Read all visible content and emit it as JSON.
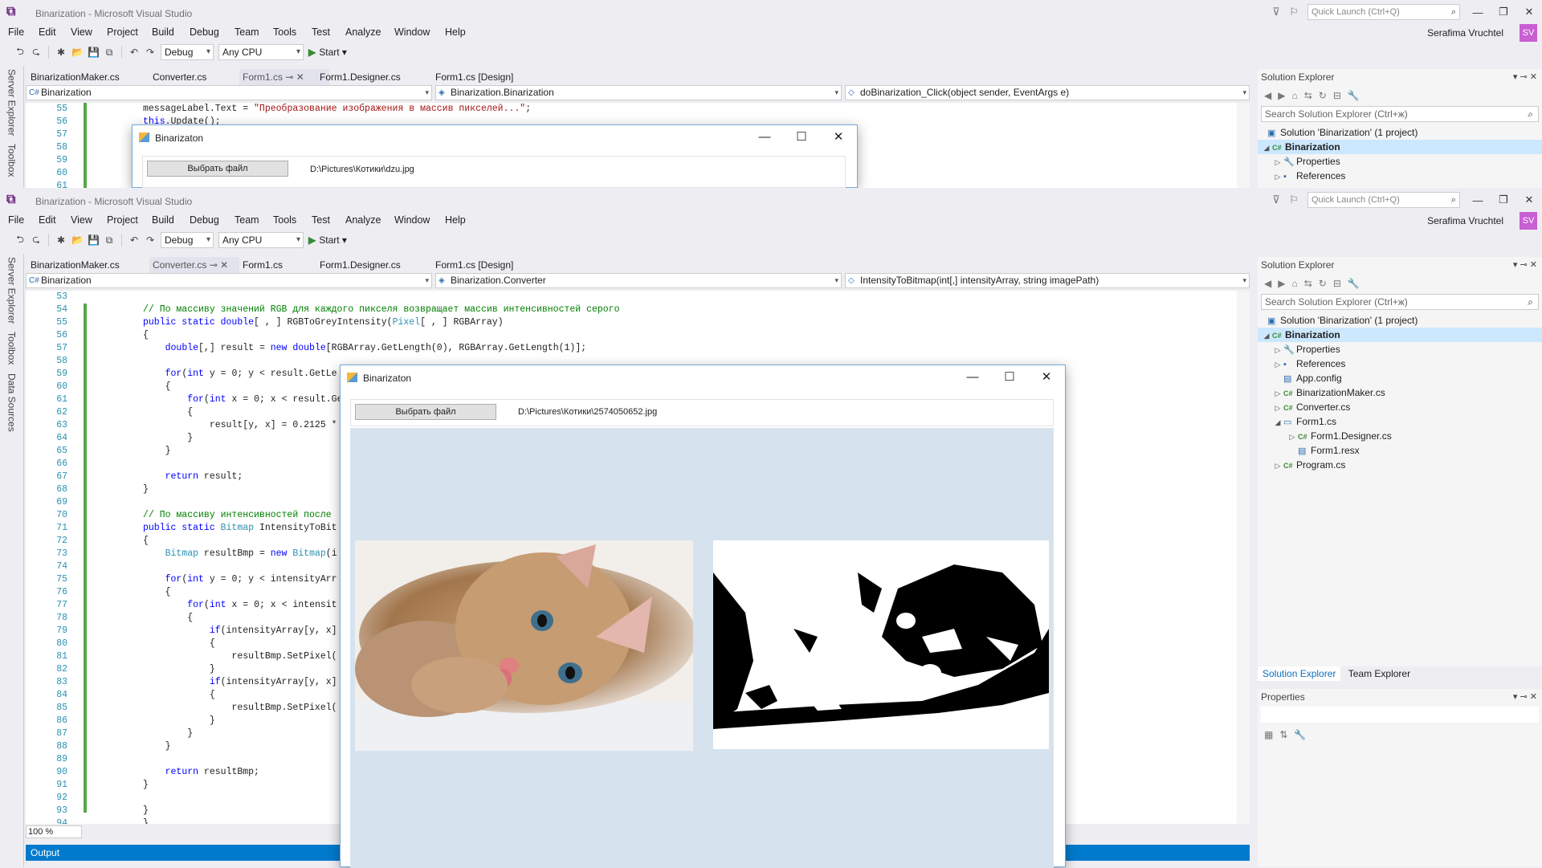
{
  "window": {
    "title": "Binarization - Microsoft Visual Studio",
    "quick_launch": "Quick Launch (Ctrl+Q)",
    "user": "Serafima Vruchtel",
    "avatar": "SV"
  },
  "menu": [
    "File",
    "Edit",
    "View",
    "Project",
    "Build",
    "Debug",
    "Team",
    "Tools",
    "Test",
    "Analyze",
    "Window",
    "Help"
  ],
  "toolbar": {
    "config": "Debug",
    "platform": "Any CPU",
    "start": "Start"
  },
  "side_tabs_top": [
    "Server Explorer",
    "Toolbox"
  ],
  "side_tabs_bottom": [
    "Server Explorer",
    "Toolbox",
    "Data Sources"
  ],
  "top_window": {
    "tabs": [
      "BinarizationMaker.cs",
      "Converter.cs",
      "Form1.cs",
      "Form1.Designer.cs",
      "Form1.cs [Design]"
    ],
    "nav": [
      "Binarization",
      "Binarization.Binarization",
      "doBinarization_Click(object sender, EventArgs e)"
    ],
    "lines": [
      {
        "n": "55",
        "html": "messageLabel.Text = <span class='st'>\"Преобразование изображения в массив пикселей...\"</span>;"
      },
      {
        "n": "56",
        "html": "<span class='kw'>this</span>.Update();"
      },
      {
        "n": "57",
        "html": ""
      },
      {
        "n": "58",
        "html": ""
      },
      {
        "n": "59",
        "html": ""
      },
      {
        "n": "60",
        "html": ""
      },
      {
        "n": "61",
        "html": ""
      }
    ],
    "form": {
      "title": "Binarizaton",
      "button": "Выбрать файл",
      "path": "D:\\Pictures\\Котики\\dzu.jpg"
    }
  },
  "bottom_window": {
    "tabs": [
      "BinarizationMaker.cs",
      "Converter.cs",
      "Form1.cs",
      "Form1.Designer.cs",
      "Form1.cs [Design]"
    ],
    "nav": [
      "Binarization",
      "Binarization.Converter",
      "IntensityToBitmap(int[,] intensityArray, string imagePath)"
    ],
    "lines": [
      {
        "n": "53",
        "html": ""
      },
      {
        "n": "54",
        "html": "<span class='cm'>// По массиву значений RGB для каждого пикселя возвращает массив интенсивностей серого</span>"
      },
      {
        "n": "55",
        "html": "<span class='kw'>public static double</span>[ , ] RGBToGreyIntensity(<span class='ty'>Pixel</span>[ , ] RGBArray)"
      },
      {
        "n": "56",
        "html": "{"
      },
      {
        "n": "57",
        "html": "    <span class='kw'>double</span>[,] result = <span class='kw'>new double</span>[RGBArray.GetLength(0), RGBArray.GetLength(1)];"
      },
      {
        "n": "58",
        "html": ""
      },
      {
        "n": "59",
        "html": "    <span class='kw'>for</span>(<span class='kw'>int</span> y = 0; y &lt; result.GetLe"
      },
      {
        "n": "60",
        "html": "    {"
      },
      {
        "n": "61",
        "html": "        <span class='kw'>for</span>(<span class='kw'>int</span> x = 0; x &lt; result.Ge"
      },
      {
        "n": "62",
        "html": "        {"
      },
      {
        "n": "63",
        "html": "            result[y, x] = 0.2125 *"
      },
      {
        "n": "64",
        "html": "        }"
      },
      {
        "n": "65",
        "html": "    }"
      },
      {
        "n": "66",
        "html": ""
      },
      {
        "n": "67",
        "html": "    <span class='kw'>return</span> result;"
      },
      {
        "n": "68",
        "html": "}"
      },
      {
        "n": "69",
        "html": ""
      },
      {
        "n": "70",
        "html": "<span class='cm'>// По массиву интенсивностей после</span>"
      },
      {
        "n": "71",
        "html": "<span class='kw'>public static</span> <span class='ty'>Bitmap</span> IntensityToBit"
      },
      {
        "n": "72",
        "html": "{"
      },
      {
        "n": "73",
        "html": "    <span class='ty'>Bitmap</span> resultBmp = <span class='kw'>new</span> <span class='ty'>Bitmap</span>(i"
      },
      {
        "n": "74",
        "html": ""
      },
      {
        "n": "75",
        "html": "    <span class='kw'>for</span>(<span class='kw'>int</span> y = 0; y &lt; intensityArr"
      },
      {
        "n": "76",
        "html": "    {"
      },
      {
        "n": "77",
        "html": "        <span class='kw'>for</span>(<span class='kw'>int</span> x = 0; x &lt; intensit"
      },
      {
        "n": "78",
        "html": "        {"
      },
      {
        "n": "79",
        "html": "            <span class='kw'>if</span>(intensityArray[y, x]"
      },
      {
        "n": "80",
        "html": "            {"
      },
      {
        "n": "81",
        "html": "                resultBmp.SetPixel("
      },
      {
        "n": "82",
        "html": "            }"
      },
      {
        "n": "83",
        "html": "            <span class='kw'>if</span>(intensityArray[y, x]"
      },
      {
        "n": "84",
        "html": "            {"
      },
      {
        "n": "85",
        "html": "                resultBmp.SetPixel("
      },
      {
        "n": "86",
        "html": "            }"
      },
      {
        "n": "87",
        "html": "        }"
      },
      {
        "n": "88",
        "html": "    }"
      },
      {
        "n": "89",
        "html": ""
      },
      {
        "n": "90",
        "html": "    <span class='kw'>return</span> resultBmp;"
      },
      {
        "n": "91",
        "html": "}"
      },
      {
        "n": "92",
        "html": ""
      },
      {
        "n": "93",
        "html": "}"
      },
      {
        "n": "94",
        "html": "}"
      }
    ],
    "form": {
      "title": "Binarizaton",
      "button": "Выбрать файл",
      "path": "D:\\Pictures\\Котики\\2574050652.jpg"
    },
    "zoom": "100 %",
    "output": "Output"
  },
  "solution_explorer": {
    "title": "Solution Explorer",
    "search": "Search Solution Explorer (Ctrl+ж)",
    "search_top": "Search Solution Explorer (Ctrl+ж)",
    "solution": "Solution 'Binarization' (1 project)",
    "project": "Binarization",
    "items": [
      {
        "label": "Properties",
        "icon": "wrench-icon",
        "level": 2,
        "arrow": "▷"
      },
      {
        "label": "References",
        "icon": "references-icon",
        "level": 2,
        "arrow": "▷"
      },
      {
        "label": "App.config",
        "icon": "config-file-icon",
        "level": 2,
        "arrow": ""
      },
      {
        "label": "BinarizationMaker.cs",
        "icon": "csharp-file-icon",
        "level": 2,
        "arrow": "▷"
      },
      {
        "label": "Converter.cs",
        "icon": "csharp-file-icon",
        "level": 2,
        "arrow": "▷"
      },
      {
        "label": "Form1.cs",
        "icon": "form-icon",
        "level": 2,
        "arrow": "◢"
      },
      {
        "label": "Form1.Designer.cs",
        "icon": "csharp-file-icon",
        "level": 3,
        "arrow": "▷"
      },
      {
        "label": "Form1.resx",
        "icon": "resource-icon",
        "level": 3,
        "arrow": ""
      },
      {
        "label": "Program.cs",
        "icon": "csharp-file-icon",
        "level": 2,
        "arrow": "▷"
      }
    ],
    "tabs": [
      "Solution Explorer",
      "Team Explorer"
    ]
  },
  "properties": {
    "title": "Properties"
  },
  "colors": {
    "accent": "#007acc",
    "vs_purple": "#68217a",
    "form_bg": "#d6e3ef"
  }
}
